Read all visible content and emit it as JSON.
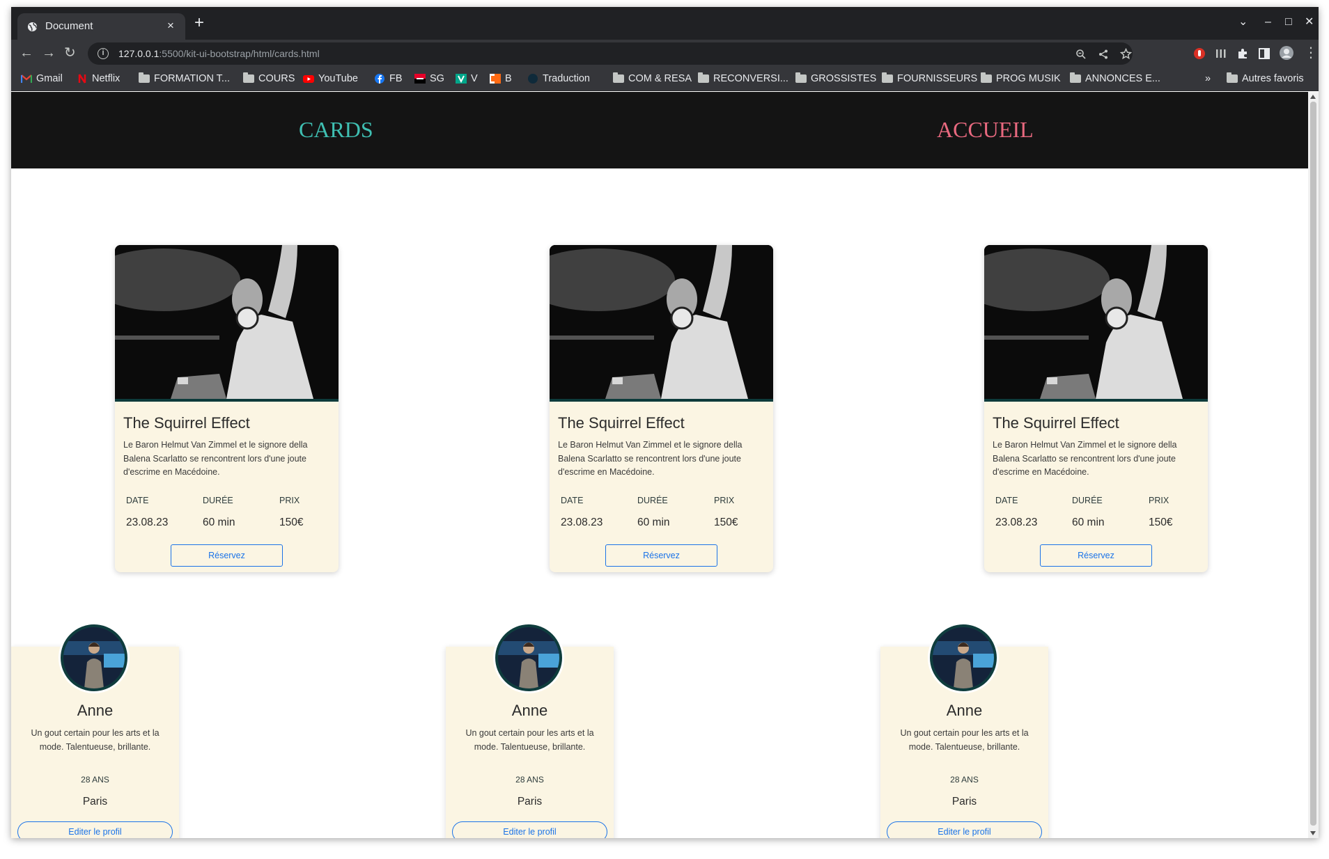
{
  "browser": {
    "tab_title": "Document",
    "tab_close": "×",
    "new_tab": "+",
    "url_host": "127.0.0.1",
    "url_path": ":5500/kit-ui-bootstrap/html/cards.html",
    "window_controls": {
      "collapse": "⌄",
      "minimize": "–",
      "maximize": "□",
      "close": "✕"
    },
    "bookmarks": [
      {
        "label": "Gmail",
        "icon": "gmail-icon"
      },
      {
        "label": "Netflix",
        "icon": "netflix-icon"
      },
      {
        "label": "FORMATION T...",
        "icon": "folder-icon"
      },
      {
        "label": "COURS",
        "icon": "folder-icon"
      },
      {
        "label": "YouTube",
        "icon": "youtube-icon"
      },
      {
        "label": "FB",
        "icon": "facebook-icon"
      },
      {
        "label": "SG",
        "icon": "sg-icon"
      },
      {
        "label": "V",
        "icon": "v-icon"
      },
      {
        "label": "B",
        "icon": "b-icon"
      },
      {
        "label": "Traduction",
        "icon": "translate-icon"
      },
      {
        "label": "COM & RESA",
        "icon": "folder-icon"
      },
      {
        "label": "RECONVERSI...",
        "icon": "folder-icon"
      },
      {
        "label": "GROSSISTES",
        "icon": "folder-icon"
      },
      {
        "label": "FOURNISSEURS",
        "icon": "folder-icon"
      },
      {
        "label": "PROG MUSIK",
        "icon": "folder-icon"
      },
      {
        "label": "ANNONCES E...",
        "icon": "folder-icon"
      }
    ],
    "bookmarks_overflow": "»",
    "other_bookmarks": "Autres favoris"
  },
  "site": {
    "nav": {
      "cards": "CARDS",
      "home": "ACCUEIL"
    },
    "event_cards": [
      {
        "title": "The Squirrel Effect",
        "description": "Le Baron Helmut Van Zimmel et le signore della Balena Scarlatto se rencontrent lors d'une joute d'escrime en Macédoine.",
        "labels": [
          "DATE",
          "DURÉE",
          "PRIX"
        ],
        "values": [
          "23.08.23",
          "60 min",
          "150€"
        ],
        "button": "Réservez"
      },
      {
        "title": "The Squirrel Effect",
        "description": "Le Baron Helmut Van Zimmel et le signore della Balena Scarlatto se rencontrent lors d'une joute d'escrime en Macédoine.",
        "labels": [
          "DATE",
          "DURÉE",
          "PRIX"
        ],
        "values": [
          "23.08.23",
          "60 min",
          "150€"
        ],
        "button": "Réservez"
      },
      {
        "title": "The Squirrel Effect",
        "description": "Le Baron Helmut Van Zimmel et le signore della Balena Scarlatto se rencontrent lors d'une joute d'escrime en Macédoine.",
        "labels": [
          "DATE",
          "DURÉE",
          "PRIX"
        ],
        "values": [
          "23.08.23",
          "60 min",
          "150€"
        ],
        "button": "Réservez"
      }
    ],
    "profile_cards": [
      {
        "name": "Anne",
        "description": "Un gout certain pour les arts et la mode. Talentueuse, brillante.",
        "age": "28 ANS",
        "city": "Paris",
        "button": "Editer le profil"
      },
      {
        "name": "Anne",
        "description": "Un gout certain pour les arts et la mode. Talentueuse, brillante.",
        "age": "28 ANS",
        "city": "Paris",
        "button": "Editer le profil"
      },
      {
        "name": "Anne",
        "description": "Un gout certain pour les arts et la mode. Talentueuse, brillante.",
        "age": "28 ANS",
        "city": "Paris",
        "button": "Editer le profil"
      }
    ]
  },
  "colors": {
    "nav_bg": "#141414",
    "nav_cards": "#3fbfb2",
    "nav_home": "#e8697f",
    "card_bg": "#fbf5e3",
    "button_accent": "#1a73e8"
  }
}
